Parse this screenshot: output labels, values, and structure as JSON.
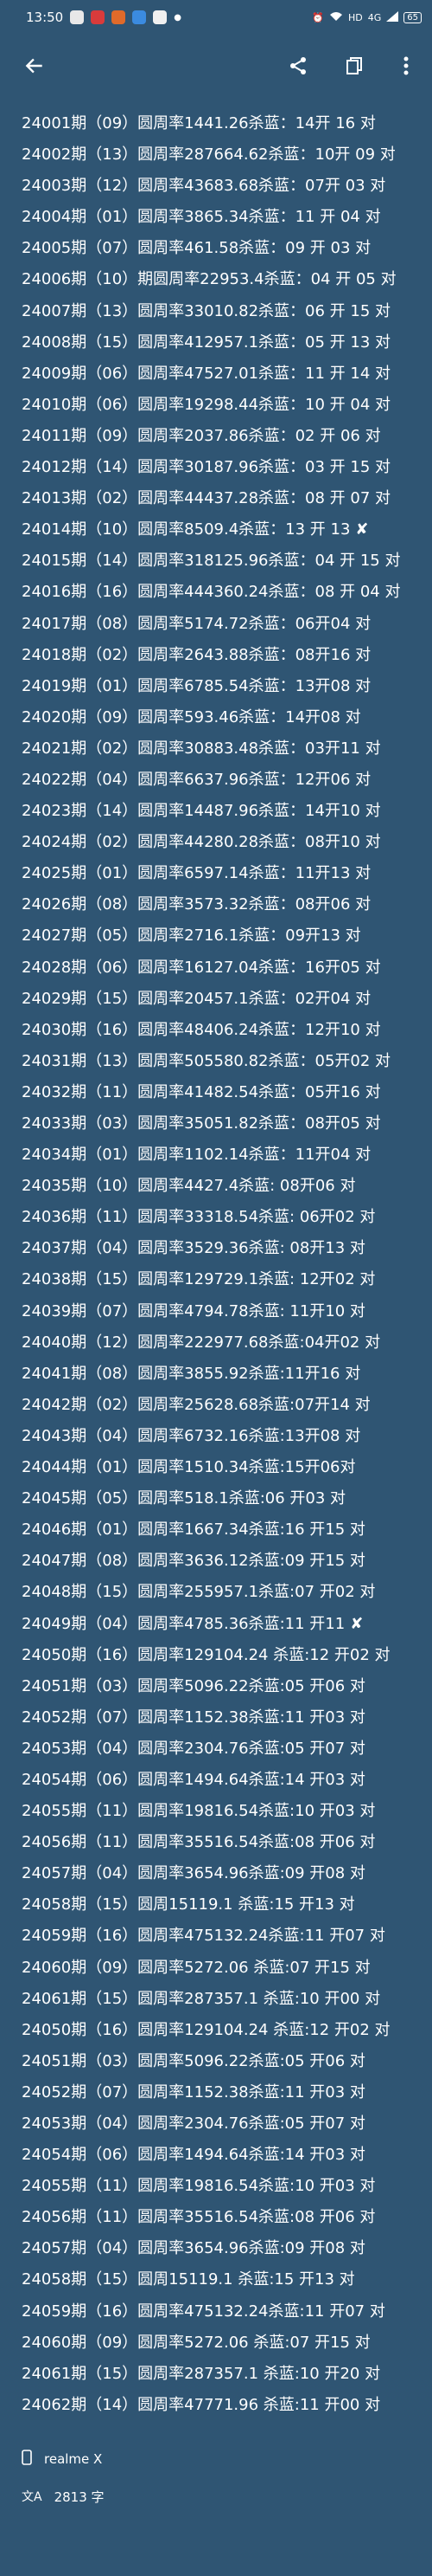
{
  "status": {
    "time": "13:50",
    "network": "HD",
    "signal_label": "4G",
    "battery": "65"
  },
  "rows": [
    "24001期（09）圆周率1441.26杀蓝：14开 16 对",
    "24002期（13）圆周率287664.62杀蓝：10开 09 对",
    "24003期（12）圆周率43683.68杀蓝：07开 03 对",
    "24004期（01）圆周率3865.34杀蓝：11 开 04 对",
    "24005期（07）圆周率461.58杀蓝：09 开 03 对",
    "24006期（10）期圆周率22953.4杀蓝：04 开 05 对",
    "24007期（13）圆周率33010.82杀蓝：06 开 15 对",
    "24008期（15）圆周率412957.1杀蓝：05 开 13 对",
    "24009期（06）圆周率47527.01杀蓝：11 开 14 对",
    "24010期（06）圆周率19298.44杀蓝：10 开 04 对",
    "24011期（09）圆周率2037.86杀蓝：02 开 06 对",
    "24012期（14）圆周率30187.96杀蓝：03 开 15 对",
    "24013期（02）圆周率44437.28杀蓝：08 开 07 对",
    "24014期（10）圆周率8509.4杀蓝：13 开 13",
    "24015期（14）圆周率318125.96杀蓝：04 开 15 对",
    "24016期（16）圆周率444360.24杀蓝：08 开 04 对",
    "24017期（08）圆周率5174.72杀蓝：06开04 对",
    "24018期（02）圆周率2643.88杀蓝：08开16 对",
    "24019期（01）圆周率6785.54杀蓝：13开08 对",
    "24020期（09）圆周率593.46杀蓝：14开08 对",
    "24021期（02）圆周率30883.48杀蓝：03开11 对",
    "24022期（04）圆周率6637.96杀蓝：12开06 对",
    "24023期（14）圆周率14487.96杀蓝：14开10 对",
    "24024期（02）圆周率44280.28杀蓝：08开10 对",
    "24025期（01）圆周率6597.14杀蓝：11开13  对",
    "24026期（08）圆周率3573.32杀蓝：08开06  对",
    "24027期（05）圆周率2716.1杀蓝：09开13 对",
    "24028期（06）圆周率16127.04杀蓝：16开05 对",
    "24029期（15）圆周率20457.1杀蓝：02开04 对",
    "24030期（16）圆周率48406.24杀蓝：12开10 对",
    "24031期（13）圆周率505580.82杀蓝：05开02 对",
    "24032期（11）圆周率41482.54杀蓝：05开16 对",
    "24033期（03）圆周率35051.82杀蓝：08开05 对",
    "24034期（01）圆周率1102.14杀蓝：11开04 对",
    "24035期（10）圆周率4427.4杀蓝: 08开06 对",
    "24036期（11）圆周率33318.54杀蓝: 06开02 对",
    "24037期（04）圆周率3529.36杀蓝: 08开13 对",
    "24038期（15）圆周率129729.1杀蓝: 12开02 对",
    "24039期（07）圆周率4794.78杀蓝: 11开10 对",
    "24040期（12）圆周率222977.68杀蓝:04开02 对",
    "24041期（08）圆周率3855.92杀蓝:11开16 对",
    "24042期（02）圆周率25628.68杀蓝:07开14 对",
    "24043期（04）圆周率6732.16杀蓝:13开08 对",
    "24044期（01）圆周率1510.34杀蓝:15开06对",
    "24045期（05）圆周率518.1杀蓝:06 开03 对",
    "24046期（01）圆周率1667.34杀蓝:16 开15 对",
    "24047期（08）圆周率3636.12杀蓝:09 开15 对",
    "24048期（15）圆周率255957.1杀蓝:07 开02 对",
    "24049期（04）圆周率4785.36杀蓝:11  开11",
    "24050期（16）圆周率129104.24 杀蓝:12 开02 对",
    "24051期（03）圆周率5096.22杀蓝:05  开06 对",
    "24052期（07）圆周率1152.38杀蓝:11  开03 对",
    "24053期（04）圆周率2304.76杀蓝:05  开07 对",
    "24054期（06）圆周率1494.64杀蓝:14  开03 对",
    "24055期（11）圆周率19816.54杀蓝:10  开03 对",
    "24056期（11）圆周率35516.54杀蓝:08  开06 对",
    "24057期（04）圆周率3654.96杀蓝:09  开08 对",
    "24058期（15）圆周15119.1 杀蓝:15  开13 对",
    "24059期（16）圆周率475132.24杀蓝:11  开07  对",
    "24060期（09）圆周率5272.06 杀蓝:07  开15 对",
    "24061期（15）圆周率287357.1 杀蓝:10  开00 对",
    "24050期（16）圆周率129104.24 杀蓝:12 开02 对",
    "24051期（03）圆周率5096.22杀蓝:05  开06 对",
    "24052期（07）圆周率1152.38杀蓝:11  开03 对",
    "24053期（04）圆周率2304.76杀蓝:05  开07 对",
    "24054期（06）圆周率1494.64杀蓝:14  开03 对",
    "24055期（11）圆周率19816.54杀蓝:10  开03 对",
    "24056期（11）圆周率35516.54杀蓝:08  开06 对",
    "24057期（04）圆周率3654.96杀蓝:09  开08 对",
    "24058期（15）圆周15119.1 杀蓝:15  开13 对",
    "24059期（16）圆周率475132.24杀蓝:11  开07  对",
    "24060期（09）圆周率5272.06 杀蓝:07  开15 对",
    "24061期（15）圆周率287357.1 杀蓝:10  开20 对",
    "24062期（14）圆周率47771.96  杀蓝:11  开00 对"
  ],
  "marks": {
    "row_13": "✘",
    "row_48": "✘"
  },
  "footer": {
    "device": "realme X",
    "char_count": "2813 字"
  }
}
